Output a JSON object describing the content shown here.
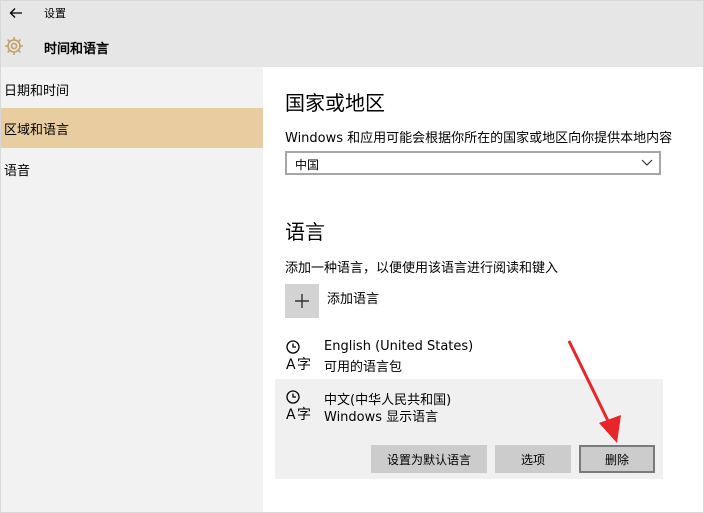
{
  "titlebar": {
    "app_title": "设置",
    "section_title": "时间和语言"
  },
  "sidebar": {
    "items": [
      {
        "label": "日期和时间",
        "active": false
      },
      {
        "label": "区域和语言",
        "active": true
      },
      {
        "label": "语音",
        "active": false
      }
    ]
  },
  "region": {
    "heading": "国家或地区",
    "description": "Windows 和应用可能会根据你所在的国家或地区向你提供本地内容",
    "selected_country": "中国"
  },
  "language": {
    "heading": "语言",
    "description": "添加一种语言，以便使用该语言进行阅读和键入",
    "add_label": "添加语言",
    "items": [
      {
        "name": "English (United States)",
        "sub": "可用的语言包"
      },
      {
        "name": "中文(中华人民共和国)",
        "sub": "Windows 显示语言"
      }
    ],
    "buttons": {
      "set_default": "设置为默认语言",
      "options": "选项",
      "remove": "删除"
    }
  },
  "colors": {
    "accent": "#e8cda1",
    "annotation_arrow": "#e8262a"
  }
}
